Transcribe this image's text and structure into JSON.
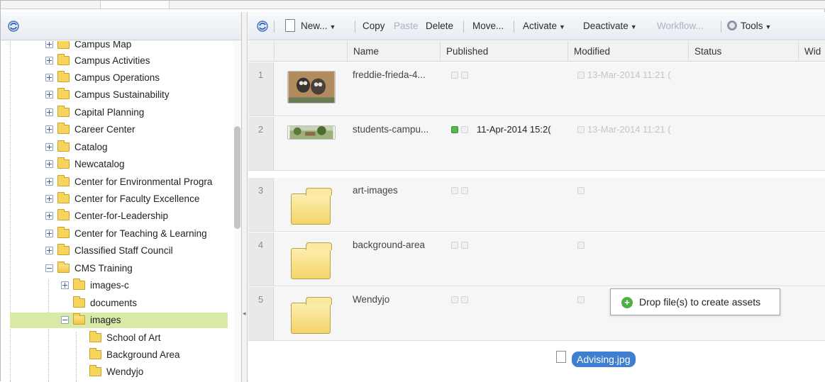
{
  "tree": {
    "items": [
      {
        "label": "Campus Map"
      },
      {
        "label": "Campus Activities"
      },
      {
        "label": "Campus Operations"
      },
      {
        "label": "Campus Sustainability"
      },
      {
        "label": "Capital Planning"
      },
      {
        "label": "Career Center"
      },
      {
        "label": "Catalog"
      },
      {
        "label": "Newcatalog"
      },
      {
        "label": "Center for Environmental Progra"
      },
      {
        "label": "Center for Faculty Excellence"
      },
      {
        "label": "Center-for-Leadership"
      },
      {
        "label": "Center for Teaching & Learning"
      },
      {
        "label": "Classified Staff Council"
      },
      {
        "label": "CMS Training"
      },
      {
        "label": "images-c"
      },
      {
        "label": "documents"
      },
      {
        "label": "images"
      },
      {
        "label": "School of Art"
      },
      {
        "label": "Background Area"
      },
      {
        "label": "Wendyjo"
      }
    ],
    "selected": "images"
  },
  "toolbar": {
    "new_label": "New...",
    "copy_label": "Copy",
    "paste_label": "Paste",
    "delete_label": "Delete",
    "move_label": "Move...",
    "activate_label": "Activate",
    "deactivate_label": "Deactivate",
    "workflow_label": "Workflow...",
    "tools_label": "Tools"
  },
  "grid": {
    "columns": [
      "Name",
      "Published",
      "Modified",
      "Status",
      "Wid"
    ],
    "rows": [
      {
        "num": "1",
        "name": "freddie-frieda-4...",
        "published": "",
        "modified": "13-Mar-2014 11:21 (",
        "kind": "image",
        "published_active": false
      },
      {
        "num": "2",
        "name": "students-campu...",
        "published": "11-Apr-2014 15:2(",
        "modified": "13-Mar-2014 11:21 (",
        "kind": "image",
        "published_active": true
      },
      {
        "num": "3",
        "name": "art-images",
        "published": "",
        "modified": "",
        "kind": "folder",
        "published_active": false
      },
      {
        "num": "4",
        "name": "background-area",
        "published": "",
        "modified": "",
        "kind": "folder",
        "published_active": false
      },
      {
        "num": "5",
        "name": "Wendyjo",
        "published": "",
        "modified": "",
        "kind": "folder",
        "published_active": false
      }
    ]
  },
  "drop_tooltip": {
    "text": "Drop file(s) to create assets"
  },
  "dragging_file": {
    "name": "Advising.jpg"
  },
  "colors": {
    "selected_row": "#d8e9a8",
    "drag_pill": "#3f7fd1",
    "publish_active": "#55b94b"
  }
}
